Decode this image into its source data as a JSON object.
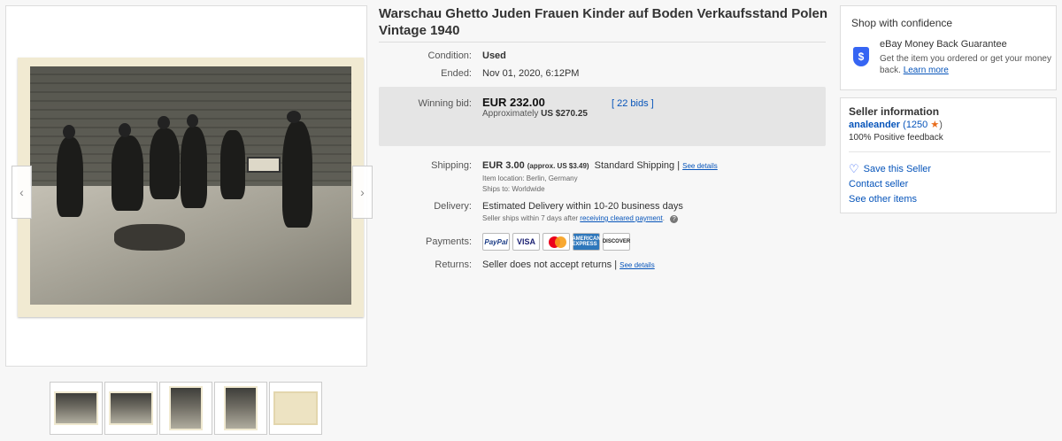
{
  "item": {
    "title": "Warschau Ghetto Juden Frauen Kinder auf Boden Verkaufsstand Polen Vintage 1940"
  },
  "gallery": {
    "prev_icon": "chevron-left-icon",
    "next_icon": "chevron-right-icon",
    "prev_glyph": "‹",
    "next_glyph": "›",
    "thumbnail_count": 5
  },
  "details": {
    "condition_label": "Condition:",
    "condition_value": "Used",
    "ended_label": "Ended:",
    "ended_value": "Nov 01, 2020, 6:12PM",
    "winning_bid_label": "Winning bid:",
    "winning_bid_value": "EUR 232.00",
    "approx_prefix": "Approximately",
    "approx_value": "US $270.25",
    "bids_prefix": "[",
    "bids_link": "22 bids",
    "bids_suffix": "]",
    "shipping_label": "Shipping:",
    "shipping_value": "EUR 3.00",
    "shipping_approx": "(approx. US $3.49)",
    "shipping_method": "Standard Shipping |",
    "shipping_see_details": "See details",
    "item_location": "Item location:  Berlin, Germany",
    "ships_to": "Ships to:  Worldwide",
    "delivery_label": "Delivery:",
    "delivery_value": "Estimated Delivery within 10-20 business days",
    "delivery_note_prefix": "Seller ships within 7 days after",
    "delivery_note_link": "receiving cleared payment",
    "delivery_note_suffix": ".",
    "payments_label": "Payments:",
    "payment_methods": [
      "PayPal",
      "VISA",
      "",
      "AMERICAN EXPRESS",
      "DISCOVER"
    ],
    "returns_label": "Returns:",
    "returns_value": "Seller does not accept returns |",
    "returns_see_details": "See details"
  },
  "confidence": {
    "title": "Shop with confidence",
    "guarantee_title": "eBay Money Back Guarantee",
    "guarantee_text": "Get the item you ordered or get your money back.",
    "learn_more": "Learn more",
    "shield_glyph": "$"
  },
  "seller": {
    "title": "Seller information",
    "name": "analeander",
    "feedback_open": "(1250",
    "feedback_close": ")",
    "star_glyph": "★",
    "positive": "100% Positive feedback",
    "save_seller": "Save this Seller",
    "heart_glyph": "♡",
    "contact": "Contact seller",
    "other_items": "See other items"
  },
  "colors": {
    "link": "#0654ba",
    "accent_blue": "#3665f3",
    "star": "#e86c1c"
  }
}
